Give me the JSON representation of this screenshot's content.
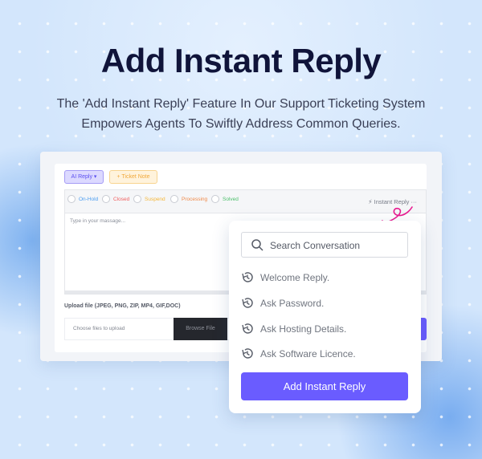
{
  "hero": {
    "title": "Add Instant Reply",
    "subtitle_line1": "The 'Add Instant Reply' Feature In Our Support Ticketing System",
    "subtitle_line2": "Empowers Agents To Swiftly Address Common Queries."
  },
  "form": {
    "ai_reply_label": "AI Reply ▾",
    "ticket_note_label": "+ Ticket Note",
    "statuses": [
      {
        "label": "On-Hold",
        "color": "#4a9cf0"
      },
      {
        "label": "Closed",
        "color": "#f06060"
      },
      {
        "label": "Suspend",
        "color": "#f5b73a"
      },
      {
        "label": "Processing",
        "color": "#f08a4a"
      },
      {
        "label": "Solved",
        "color": "#4cbf6a"
      }
    ],
    "instant_reply_label": "Instant Reply ···",
    "message_placeholder": "Type in your massage...",
    "upload_label": "Upload file (JPEG, PNG, ZIP, MP4, GIF,DOC)",
    "upload_placeholder": "Choose files to upload",
    "browse_label": "Browse File"
  },
  "popup": {
    "search_placeholder": "Search Conversation",
    "items": [
      {
        "label": "Welcome Reply.",
        "icon": "history-icon"
      },
      {
        "label": "Ask Password.",
        "icon": "history-icon"
      },
      {
        "label": "Ask Hosting Details.",
        "icon": "history-icon"
      },
      {
        "label": "Ask Software Licence.",
        "icon": "history-icon"
      }
    ],
    "add_button_label": "Add Instant Reply"
  },
  "colors": {
    "accent": "#6a5cff",
    "annotation": "#e8198f"
  }
}
